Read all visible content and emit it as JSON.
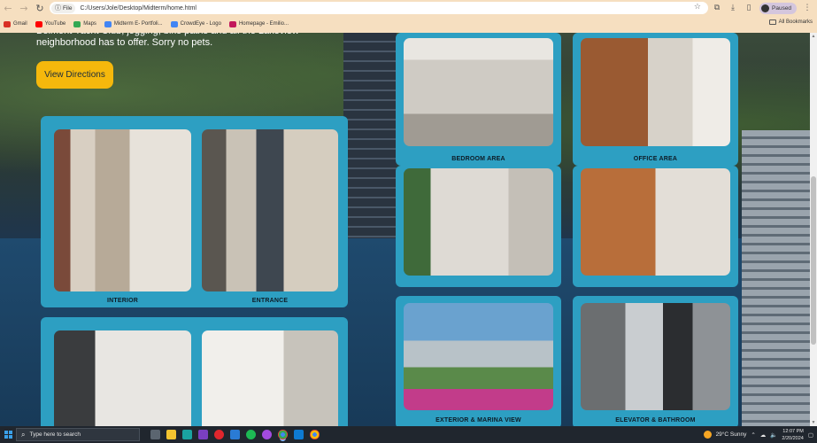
{
  "browser": {
    "nav": {
      "back": "←",
      "forward": "→",
      "reload": "↻"
    },
    "file_chip": "File",
    "url": "C:/Users/Jole/Desktop/Midterm/home.html",
    "profile_status": "Paused",
    "bookmarks": [
      {
        "label": "Gmail",
        "color": "#d93025"
      },
      {
        "label": "YouTube",
        "color": "#ff0000"
      },
      {
        "label": "Maps",
        "color": "#34a853"
      },
      {
        "label": "Midterm E- Portfoli...",
        "color": "#4285f4"
      },
      {
        "label": "CrowdEye - Logo",
        "color": "#4285f4"
      },
      {
        "label": "Homepage - Emilio...",
        "color": "#c2185b"
      }
    ],
    "all_bookmarks": "All Bookmarks"
  },
  "hero": {
    "text": "Belmont Yacht Club, jogging, bike paths and all the Lakeview neighborhood has to offer. Sorry no pets.",
    "directions_button": "View Directions"
  },
  "gallery": {
    "left_card_1": {
      "captions": [
        "INTERIOR",
        "ENTRANCE"
      ]
    },
    "right_tiles": [
      {
        "caption": "BEDROOM AREA"
      },
      {
        "caption": "OFFICE AREA"
      },
      {
        "caption": "EXTERIOR & MARINA VIEW"
      },
      {
        "caption": "ELEVATOR & BATHROOM"
      }
    ]
  },
  "taskbar": {
    "search_placeholder": "Type here to search",
    "weather": "29°C  Sunny",
    "time": "12:07 PM",
    "date": "2/20/2024",
    "colors": {
      "bg": "#20262e",
      "accent": "#3aa0e8"
    }
  },
  "theme": {
    "card": "#2d9fc2",
    "button": "#f5b80c"
  }
}
